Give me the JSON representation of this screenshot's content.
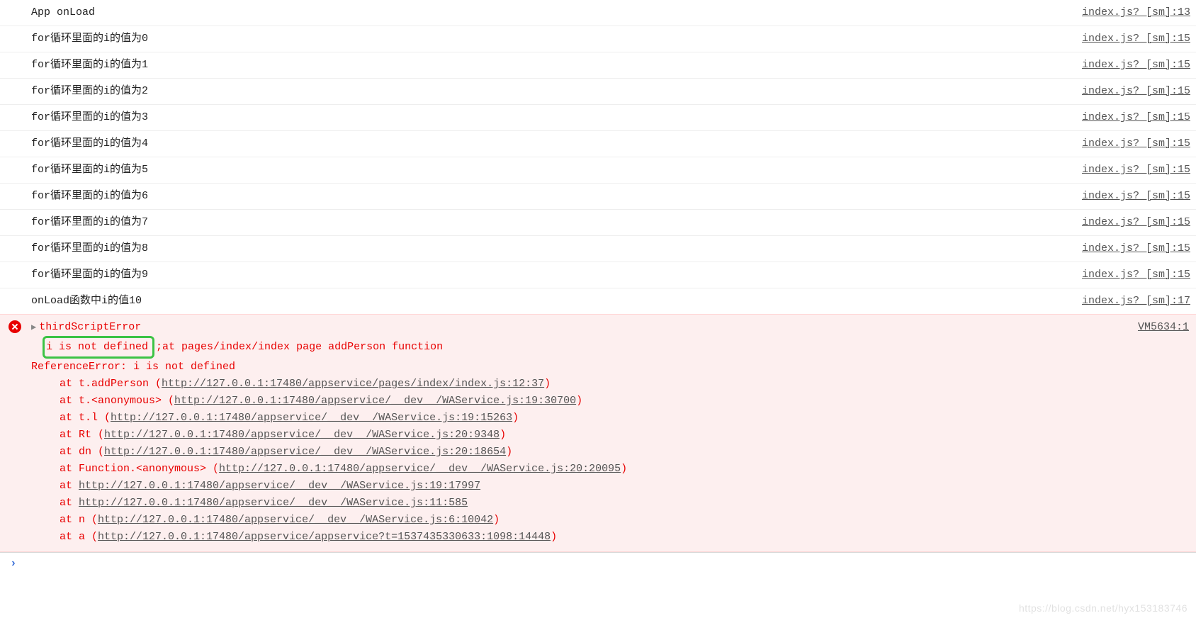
{
  "logs": [
    {
      "message": "App onLoad",
      "source": "index.js? [sm]:13"
    },
    {
      "message": "for循环里面的i的值为0",
      "source": "index.js? [sm]:15"
    },
    {
      "message": "for循环里面的i的值为1",
      "source": "index.js? [sm]:15"
    },
    {
      "message": "for循环里面的i的值为2",
      "source": "index.js? [sm]:15"
    },
    {
      "message": "for循环里面的i的值为3",
      "source": "index.js? [sm]:15"
    },
    {
      "message": "for循环里面的i的值为4",
      "source": "index.js? [sm]:15"
    },
    {
      "message": "for循环里面的i的值为5",
      "source": "index.js? [sm]:15"
    },
    {
      "message": "for循环里面的i的值为6",
      "source": "index.js? [sm]:15"
    },
    {
      "message": "for循环里面的i的值为7",
      "source": "index.js? [sm]:15"
    },
    {
      "message": "for循环里面的i的值为8",
      "source": "index.js? [sm]:15"
    },
    {
      "message": "for循环里面的i的值为9",
      "source": "index.js? [sm]:15"
    },
    {
      "message": "onLoad函数中i的值10",
      "source": "index.js? [sm]:17"
    }
  ],
  "error": {
    "sourceLink": "VM5634:1",
    "title": "thirdScriptError",
    "highlighted": "i is not defined",
    "afterHighlight": ";at pages/index/index page addPerson function",
    "referenceLine": "ReferenceError: i is not defined",
    "stack": [
      {
        "prefix": "at t.addPerson (",
        "url": "http://127.0.0.1:17480/appservice/pages/index/index.js:12:37",
        "suffix": ")"
      },
      {
        "prefix": "at t.<anonymous> (",
        "url": "http://127.0.0.1:17480/appservice/__dev__/WAService.js:19:30700",
        "suffix": ")"
      },
      {
        "prefix": "at t.l (",
        "url": "http://127.0.0.1:17480/appservice/__dev__/WAService.js:19:15263",
        "suffix": ")"
      },
      {
        "prefix": "at Rt (",
        "url": "http://127.0.0.1:17480/appservice/__dev__/WAService.js:20:9348",
        "suffix": ")"
      },
      {
        "prefix": "at dn (",
        "url": "http://127.0.0.1:17480/appservice/__dev__/WAService.js:20:18654",
        "suffix": ")"
      },
      {
        "prefix": "at Function.<anonymous> (",
        "url": "http://127.0.0.1:17480/appservice/__dev__/WAService.js:20:20095",
        "suffix": ")"
      },
      {
        "prefix": "at ",
        "url": "http://127.0.0.1:17480/appservice/__dev__/WAService.js:19:17997",
        "suffix": ""
      },
      {
        "prefix": "at ",
        "url": "http://127.0.0.1:17480/appservice/__dev__/WAService.js:11:585",
        "suffix": ""
      },
      {
        "prefix": "at n (",
        "url": "http://127.0.0.1:17480/appservice/__dev__/WAService.js:6:10042",
        "suffix": ")"
      },
      {
        "prefix": "at a (",
        "url": "http://127.0.0.1:17480/appservice/appservice?t=1537435330633:1098:14448",
        "suffix": ")"
      }
    ]
  },
  "watermark": "https://blog.csdn.net/hyx153183746"
}
